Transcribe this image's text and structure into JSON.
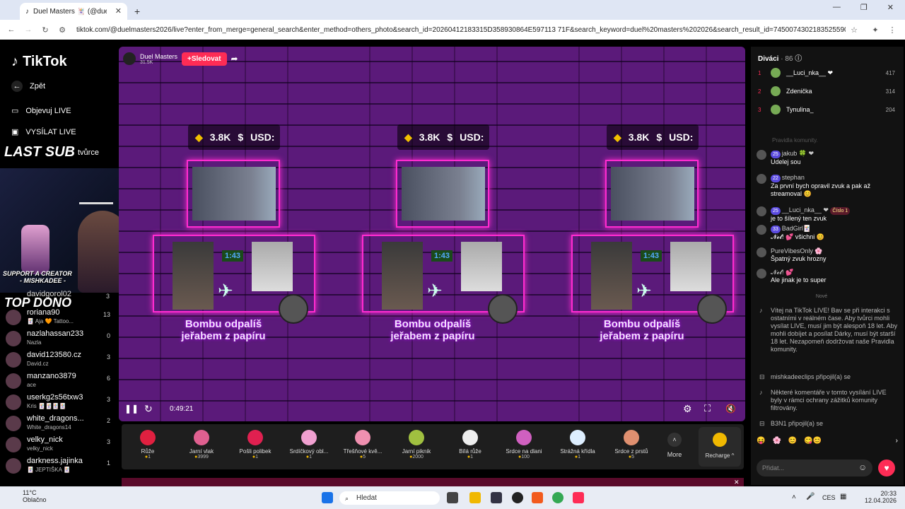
{
  "browser": {
    "tab_title": "Duel Masters 🃏 (@duelma",
    "new_tab": "+",
    "url": "tiktok.com/@duelmasters2026/live?enter_from_merge=general_search&enter_method=others_photo&search_id=20260412183315D358930864E597113 71F&search_keyword=duel%20masters%202026&search_result_id=7450074302183525590&search_type=ge...",
    "win_min": "—",
    "win_max": "❐",
    "win_close": "✕"
  },
  "sidebar": {
    "logo": "TikTok",
    "back": "Zpět",
    "discover": "Objevuj LIVE",
    "golive": "VYSÍLAT LIVE",
    "creator": "tvůrce",
    "last_sub": "LAST SUB",
    "support_line1": "SUPPORT A CREATOR",
    "support_line2": "- MISHKADEE -",
    "top_dono": "TOP DONO",
    "partial_donor": "davidgorol02",
    "partial_count": "3",
    "donors": [
      {
        "name": "roriana90",
        "sub": "🃏 Aja 🧡 Tattoo...",
        "count": "13"
      },
      {
        "name": "nazlahassan233",
        "sub": "Nazla",
        "count": "0"
      },
      {
        "name": "david123580.cz",
        "sub": "David.cz",
        "count": "3"
      },
      {
        "name": "manzano3879",
        "sub": "ace",
        "count": "6"
      },
      {
        "name": "userkg2s56txw3",
        "sub": "Kris 🃏🃏🃏🃏",
        "count": "3"
      },
      {
        "name": "white_dragons...",
        "sub": "White_dragons14",
        "count": "2"
      },
      {
        "name": "velky_nick",
        "sub": "velky_nick",
        "count": "3"
      },
      {
        "name": "darkness.jajinka",
        "sub": "🃏 JEPTIŠKA 🃏",
        "count": "1"
      }
    ]
  },
  "stream": {
    "host": "Duel Masters",
    "host_likes": "31.5K",
    "follow": "+Sledovat",
    "coins": "3.8K",
    "usd": "USD:",
    "timer": "1:43",
    "bomb_line1": "Bombu odpalíš",
    "bomb_line2": "jeřabem z papíru",
    "elapsed": "0:49:21"
  },
  "gifts": [
    {
      "name": "Růže",
      "price": "1"
    },
    {
      "name": "Jarní vlak",
      "price": "3999"
    },
    {
      "name": "Pošli polibek",
      "price": "1"
    },
    {
      "name": "Srdíčkový obl...",
      "price": "1"
    },
    {
      "name": "Třešňové kvě...",
      "price": "5"
    },
    {
      "name": "Jarní piknik",
      "price": "2000"
    },
    {
      "name": "Bílá růže",
      "price": "1"
    },
    {
      "name": "Srdce na dlani",
      "price": "100"
    },
    {
      "name": "Strážná křídla",
      "price": "1"
    },
    {
      "name": "Srdce z prstů",
      "price": "5"
    }
  ],
  "gift_more": "More",
  "recharge": "Recharge ^",
  "chat": {
    "viewers_label": "Diváci",
    "viewers_count": "· 86",
    "top_viewers": [
      {
        "rank": "1",
        "name": "__Luci_nka__ ❤",
        "score": "417"
      },
      {
        "rank": "2",
        "name": "Zdenička",
        "score": "314"
      },
      {
        "rank": "3",
        "name": "Tynulina_",
        "score": "204"
      }
    ],
    "faded": "Pravidla komunity.",
    "messages": [
      {
        "badge": "25",
        "user": "jakub 🍀 ❤",
        "text": "Udelej sou"
      },
      {
        "badge": "22",
        "user": "stephan",
        "text": "Za první bych opravil zvuk a pak až streamoval 😊"
      },
      {
        "badge": "25",
        "user": "__Luci_nka__ ❤",
        "extra": "Číslo 1",
        "text": "je to šílený ten zvuk"
      },
      {
        "badge": "33",
        "user": "BadGirl🃏",
        "text": "𝓝𝓮𝓵! 💕 všichni 😊"
      },
      {
        "badge": "",
        "user": "PureVibesOnly 🌸",
        "text": "Špatný zvuk hrozny"
      },
      {
        "badge": "",
        "user": "𝓝𝓮𝓵! 💕",
        "text": "Ale jinak je to super"
      }
    ],
    "new_label": "Nové",
    "system1": "Vítej na TikTok LIVE! Bav se při interakci s ostatními v reálném čase. Aby tvůrci mohli vysílat LIVE, musí jim být alespoň 18 let. Aby mohli dobíjet a posílat Dárky, musí být starší 18 let. Nezapomeň dodržovat naše Pravidla komunity.",
    "join1": "mishkadeeclips připojil(a) se",
    "system2": "Některé komentáře v tomto vysílání LIVE byly v rámci ochrany zážitků komunity filtrovány.",
    "join2": "B3N1 připojil(a) se",
    "input_placeholder": "Přidat..."
  },
  "taskbar": {
    "temp": "11°C",
    "weather": "Oblačno",
    "search": "Hledat",
    "lang": "CES",
    "time": "20:33",
    "date": "12.04.2026"
  }
}
